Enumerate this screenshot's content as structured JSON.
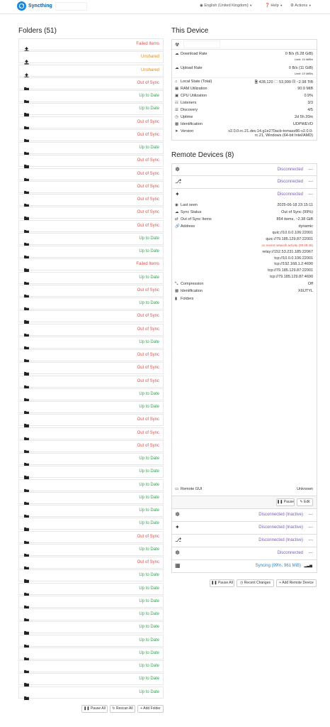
{
  "nav": {
    "brand": "Syncthing",
    "language": "English (United Kingdom)",
    "help": "Help",
    "actions": "Actions"
  },
  "folders": {
    "title": "Folders (51)",
    "items": [
      {
        "status": "Failed Items",
        "tone": "red",
        "icon": "upload"
      },
      {
        "status": "Unshared",
        "tone": "orange",
        "icon": "upload"
      },
      {
        "status": "Unshared",
        "tone": "orange",
        "icon": "upload"
      },
      {
        "status": "Out of Sync",
        "tone": "red",
        "icon": "folder"
      },
      {
        "status": "Up to Date",
        "tone": "green",
        "icon": "folder"
      },
      {
        "status": "Up to Date",
        "tone": "green",
        "icon": "folder"
      },
      {
        "status": "Out of Sync",
        "tone": "red",
        "icon": "folder"
      },
      {
        "status": "Out of Sync",
        "tone": "red",
        "icon": "folder"
      },
      {
        "status": "Up to Date",
        "tone": "green",
        "icon": "folder"
      },
      {
        "status": "Out of Sync",
        "tone": "red",
        "icon": "folder"
      },
      {
        "status": "Out of Sync",
        "tone": "red",
        "icon": "folder"
      },
      {
        "status": "Out of Sync",
        "tone": "red",
        "icon": "folder"
      },
      {
        "status": "Out of Sync",
        "tone": "red",
        "icon": "folder"
      },
      {
        "status": "Out of Sync",
        "tone": "red",
        "icon": "folder"
      },
      {
        "status": "Out of Sync",
        "tone": "red",
        "icon": "folder"
      },
      {
        "status": "Up to Date",
        "tone": "green",
        "icon": "folder"
      },
      {
        "status": "Up to Date",
        "tone": "green",
        "icon": "folder"
      },
      {
        "status": "Failed Items",
        "tone": "red",
        "icon": "folder"
      },
      {
        "status": "Up to Date",
        "tone": "green",
        "icon": "folder"
      },
      {
        "status": "Out of Sync",
        "tone": "red",
        "icon": "folder"
      },
      {
        "status": "Up to Date",
        "tone": "green",
        "icon": "folder"
      },
      {
        "status": "Out of Sync",
        "tone": "red",
        "icon": "folder"
      },
      {
        "status": "Out of Sync",
        "tone": "red",
        "icon": "folder"
      },
      {
        "status": "Up to Date",
        "tone": "green",
        "icon": "folder"
      },
      {
        "status": "Out of Sync",
        "tone": "red",
        "icon": "folder"
      },
      {
        "status": "Out of Sync",
        "tone": "red",
        "icon": "folder"
      },
      {
        "status": "Out of Sync",
        "tone": "red",
        "icon": "folder"
      },
      {
        "status": "Up to Date",
        "tone": "green",
        "icon": "folder"
      },
      {
        "status": "Up to Date",
        "tone": "green",
        "icon": "folder"
      },
      {
        "status": "Out of Sync",
        "tone": "red",
        "icon": "folder"
      },
      {
        "status": "Out of Sync",
        "tone": "red",
        "icon": "folder"
      },
      {
        "status": "Out of Sync",
        "tone": "red",
        "icon": "folder"
      },
      {
        "status": "Up to Date",
        "tone": "green",
        "icon": "folder"
      },
      {
        "status": "Up to Date",
        "tone": "green",
        "icon": "folder"
      },
      {
        "status": "Up to Date",
        "tone": "green",
        "icon": "folder"
      },
      {
        "status": "Up to Date",
        "tone": "green",
        "icon": "folder"
      },
      {
        "status": "Up to Date",
        "tone": "green",
        "icon": "folder"
      },
      {
        "status": "Up to Date",
        "tone": "green",
        "icon": "folder"
      },
      {
        "status": "Out of Sync",
        "tone": "red",
        "icon": "folder"
      },
      {
        "status": "Up to Date",
        "tone": "green",
        "icon": "folder"
      },
      {
        "status": "Out of Sync",
        "tone": "red",
        "icon": "folder"
      },
      {
        "status": "Up to Date",
        "tone": "green",
        "icon": "folder"
      },
      {
        "status": "Up to Date",
        "tone": "green",
        "icon": "folder"
      },
      {
        "status": "Up to Date",
        "tone": "green",
        "icon": "folder"
      },
      {
        "status": "Up to Date",
        "tone": "green",
        "icon": "folder"
      },
      {
        "status": "Up to Date",
        "tone": "green",
        "icon": "folder"
      },
      {
        "status": "Up to Date",
        "tone": "green",
        "icon": "folder"
      },
      {
        "status": "Up to Date",
        "tone": "green",
        "icon": "folder"
      },
      {
        "status": "Up to Date",
        "tone": "green",
        "icon": "folder"
      },
      {
        "status": "Up to Date",
        "tone": "green",
        "icon": "folder"
      },
      {
        "status": "Up to Date",
        "tone": "green",
        "icon": "folder"
      }
    ],
    "buttons": {
      "pause_all": "Pause All",
      "rescan_all": "Rescan All",
      "add_folder": "Add Folder"
    }
  },
  "this_device": {
    "title": "This Device",
    "download_label": "Download Rate",
    "download_value": "0 B/s (6.28 GiB)",
    "download_limit": "Limit: 10 MiB/s",
    "upload_label": "Upload Rate",
    "upload_value": "0 B/s (11 GiB)",
    "upload_limit": "Limit: 10 MiB/s",
    "local_state_label": "Local State (Total)",
    "local_state_files": "428,120",
    "local_state_dirs": "53,999",
    "local_state_size": "~2.98 TiB",
    "ram_label": "RAM Utilization",
    "ram_value": "90.9 MiB",
    "cpu_label": "CPU Utilization",
    "cpu_value": "0.9%",
    "listeners_label": "Listeners",
    "listeners_value": "3/3",
    "discovery_label": "Discovery",
    "discovery_value": "4/5",
    "uptime_label": "Uptime",
    "uptime_value": "2d 5h 20m",
    "ident_label": "Identification",
    "ident_value": "UDPWEVD",
    "version_label": "Version",
    "version_value_1": "v2.0.0-rc.21.dev.14.g1e270acb-tomasz86-v2.0.0-",
    "version_value_2": "rc.21, Windows (64-bit Intel/AMD)"
  },
  "remote": {
    "title": "Remote Devices (8)",
    "top_devices": [
      {
        "status": "Disconnected",
        "more": "...."
      },
      {
        "status": "Disconnected",
        "more": "...."
      },
      {
        "status": "Disconnected",
        "more": "...."
      }
    ],
    "detail": {
      "last_seen_label": "Last seen",
      "last_seen_value": "2025-06-18 23:15:11",
      "sync_status_label": "Sync Status",
      "sync_status_value": "Out of Sync (99%)",
      "oos_label": "Out of Sync Items",
      "oos_value": "854 items, ~2.38 GiB",
      "address_label": "Address",
      "addresses": [
        "dynamic",
        "quic://10.0.0.106:22001",
        "quic://79.185.129.87:22001",
        "no recent network activity (09:49:45)",
        "relay://152.53.231.185:22067",
        "tcp://10.0.0.106:22001",
        "tcp://192.168.1.2:4690",
        "tcp://79.185.129.87:22001",
        "tcp://79.185.129.87:4690"
      ],
      "compression_label": "Compression",
      "compression_value": "Off",
      "ident_label": "Identification",
      "ident_value": "X6IJTYL",
      "folders_label": "Folders",
      "remote_gui_label": "Remote GUI",
      "remote_gui_value": "Unknown",
      "pause_btn": "Pause",
      "edit_btn": "Edit"
    },
    "bottom_devices": [
      {
        "status": "Disconnected (Inactive)",
        "more": "....",
        "tone": "purple"
      },
      {
        "status": "Disconnected (Inactive)",
        "more": "....",
        "tone": "purple"
      },
      {
        "status": "Disconnected (Inactive)",
        "more": "....",
        "tone": "purple"
      },
      {
        "status": "Disconnected",
        "more": "....",
        "tone": "purple"
      },
      {
        "status": "Syncing (99%, 961 MiB)",
        "more": "",
        "tone": "blue"
      }
    ],
    "buttons": {
      "pause_all": "Pause All",
      "recent_changes": "Recent Changes",
      "add_remote": "Add Remote Device"
    }
  },
  "colors": {
    "red": "#d9534f",
    "green": "#2ea44f",
    "orange": "#e08a1c",
    "blue": "#2b87d1",
    "purple": "#7b5bb5"
  }
}
